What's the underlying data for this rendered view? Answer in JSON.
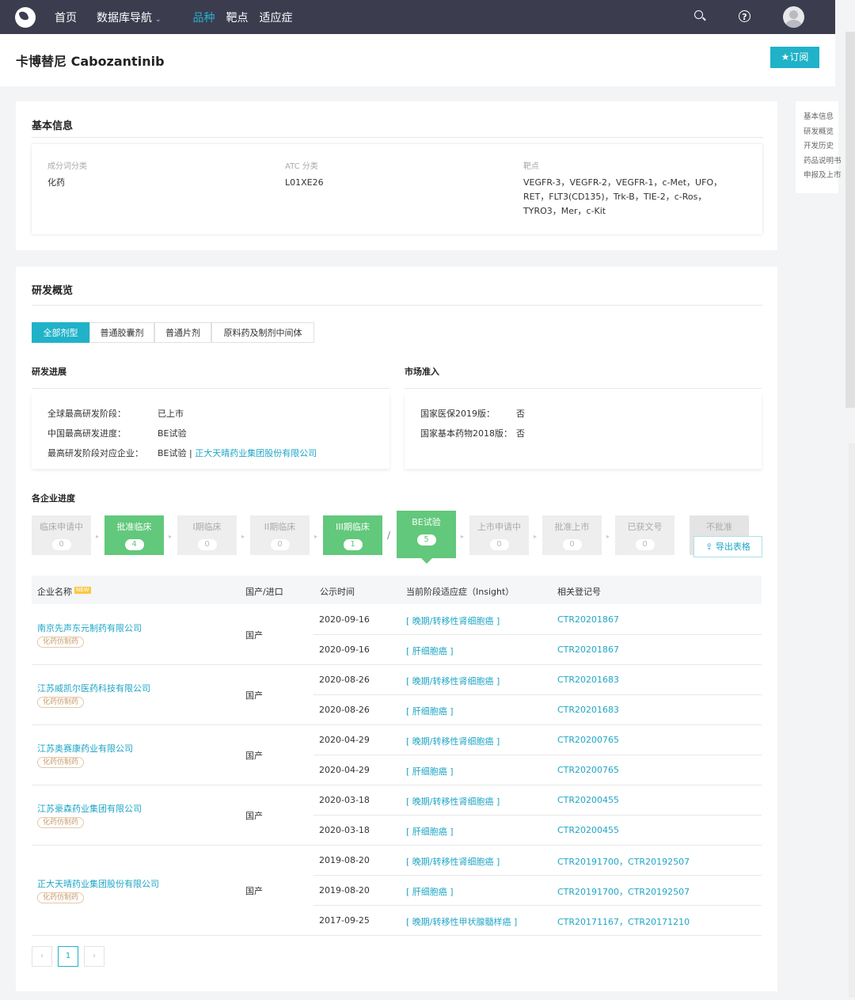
{
  "nav": {
    "home": "首页",
    "db": "数据库导航",
    "caret": "⌄",
    "variety": "品种",
    "target": "靶点",
    "indication": "适应症"
  },
  "header": {
    "title": "卡博替尼 Cabozantinib",
    "subscribe": "★订阅"
  },
  "side_nav": [
    "基本信息",
    "研发概览",
    "开发历史",
    "药品说明书",
    "申报及上市"
  ],
  "basic": {
    "title": "基本信息",
    "component_label": "成分词分类",
    "component": "化药",
    "atc_label": "ATC 分类",
    "atc": "L01XE26",
    "target_label": "靶点",
    "targets": [
      "VEGFR-3，VEGFR-2，VEGFR-1，c-Met，UFO，",
      "RET，FLT3(CD135)，Trk-B，TIE-2，c-Ros，",
      "TYRO3，Mer，c-Kit"
    ]
  },
  "overview": {
    "title": "研发概览",
    "tabs": [
      "全部剂型",
      "普通胶囊剂",
      "普通片剂",
      "原料药及制剂中间体"
    ]
  },
  "progress": {
    "title": "研发进展",
    "global_label": "全球最高研发阶段：",
    "global": "已上市",
    "china_label": "中国最高研发进度：",
    "china": "BE试验",
    "company_label": "最高研发阶段对应企业：",
    "company_stage": "BE试验 | ",
    "company": "正大天晴药业集团股份有限公司"
  },
  "market": {
    "title": "市场准入",
    "insurance_label": "国家医保2019版：",
    "insurance": "否",
    "essential_label": "国家基本药物2018版：",
    "essential": "否"
  },
  "company_progress": {
    "title": "各企业进度",
    "export": "导出表格",
    "stages": [
      {
        "name": "临床申请中",
        "count": "0"
      },
      {
        "name": "批准临床",
        "count": "4"
      },
      {
        "name": "I期临床",
        "count": "0"
      },
      {
        "name": "II期临床",
        "count": "0"
      },
      {
        "name": "III期临床",
        "count": "1"
      },
      {
        "name": "BE试验",
        "count": "5"
      },
      {
        "name": "上市申请中",
        "count": "0"
      },
      {
        "name": "批准上市",
        "count": "0"
      },
      {
        "name": "已获文号",
        "count": "0"
      },
      {
        "name": "不批准",
        "count": ""
      }
    ],
    "slash": "/"
  },
  "table": {
    "headers": {
      "company": "企业名称",
      "new": "NEW",
      "origin": "国产/进口",
      "date": "公示时间",
      "indication": "当前阶段适应症（Insight）",
      "reg": "相关登记号"
    },
    "companies": [
      {
        "name": "南京先声东元制药有限公司",
        "tag": "化药仿制药",
        "origin": "国产"
      },
      {
        "name": "江苏威凯尔医药科技有限公司",
        "tag": "化药仿制药",
        "origin": "国产"
      },
      {
        "name": "江苏奥赛康药业有限公司",
        "tag": "化药仿制药",
        "origin": "国产"
      },
      {
        "name": "江苏豪森药业集团有限公司",
        "tag": "化药仿制药",
        "origin": "国产"
      },
      {
        "name": "正大天晴药业集团股份有限公司",
        "tag": "化药仿制药",
        "origin": "国产"
      }
    ],
    "rows": [
      {
        "date": "2020-09-16",
        "ind": "[ 晚期/转移性肾细胞癌 ]",
        "reg": "CTR20201867"
      },
      {
        "date": "2020-09-16",
        "ind": "[ 肝细胞癌 ]",
        "reg": "CTR20201867"
      },
      {
        "date": "2020-08-26",
        "ind": "[ 晚期/转移性肾细胞癌 ]",
        "reg": "CTR20201683"
      },
      {
        "date": "2020-08-26",
        "ind": "[ 肝细胞癌 ]",
        "reg": "CTR20201683"
      },
      {
        "date": "2020-04-29",
        "ind": "[ 晚期/转移性肾细胞癌 ]",
        "reg": "CTR20200765"
      },
      {
        "date": "2020-04-29",
        "ind": "[ 肝细胞癌 ]",
        "reg": "CTR20200765"
      },
      {
        "date": "2020-03-18",
        "ind": "[ 晚期/转移性肾细胞癌 ]",
        "reg": "CTR20200455"
      },
      {
        "date": "2020-03-18",
        "ind": "[ 肝细胞癌 ]",
        "reg": "CTR20200455"
      },
      {
        "date": "2019-08-20",
        "ind": "[ 晚期/转移性肾细胞癌 ]",
        "reg": "CTR20191700，CTR20192507"
      },
      {
        "date": "2019-08-20",
        "ind": "[ 肝细胞癌 ]",
        "reg": "CTR20191700，CTR20192507"
      },
      {
        "date": "2017-09-25",
        "ind": "[ 晚期/转移性甲状腺髓样癌 ]",
        "reg": "CTR20171167，CTR20171210"
      }
    ]
  },
  "pagination": {
    "prev": "‹",
    "page": "1",
    "next": "›"
  }
}
